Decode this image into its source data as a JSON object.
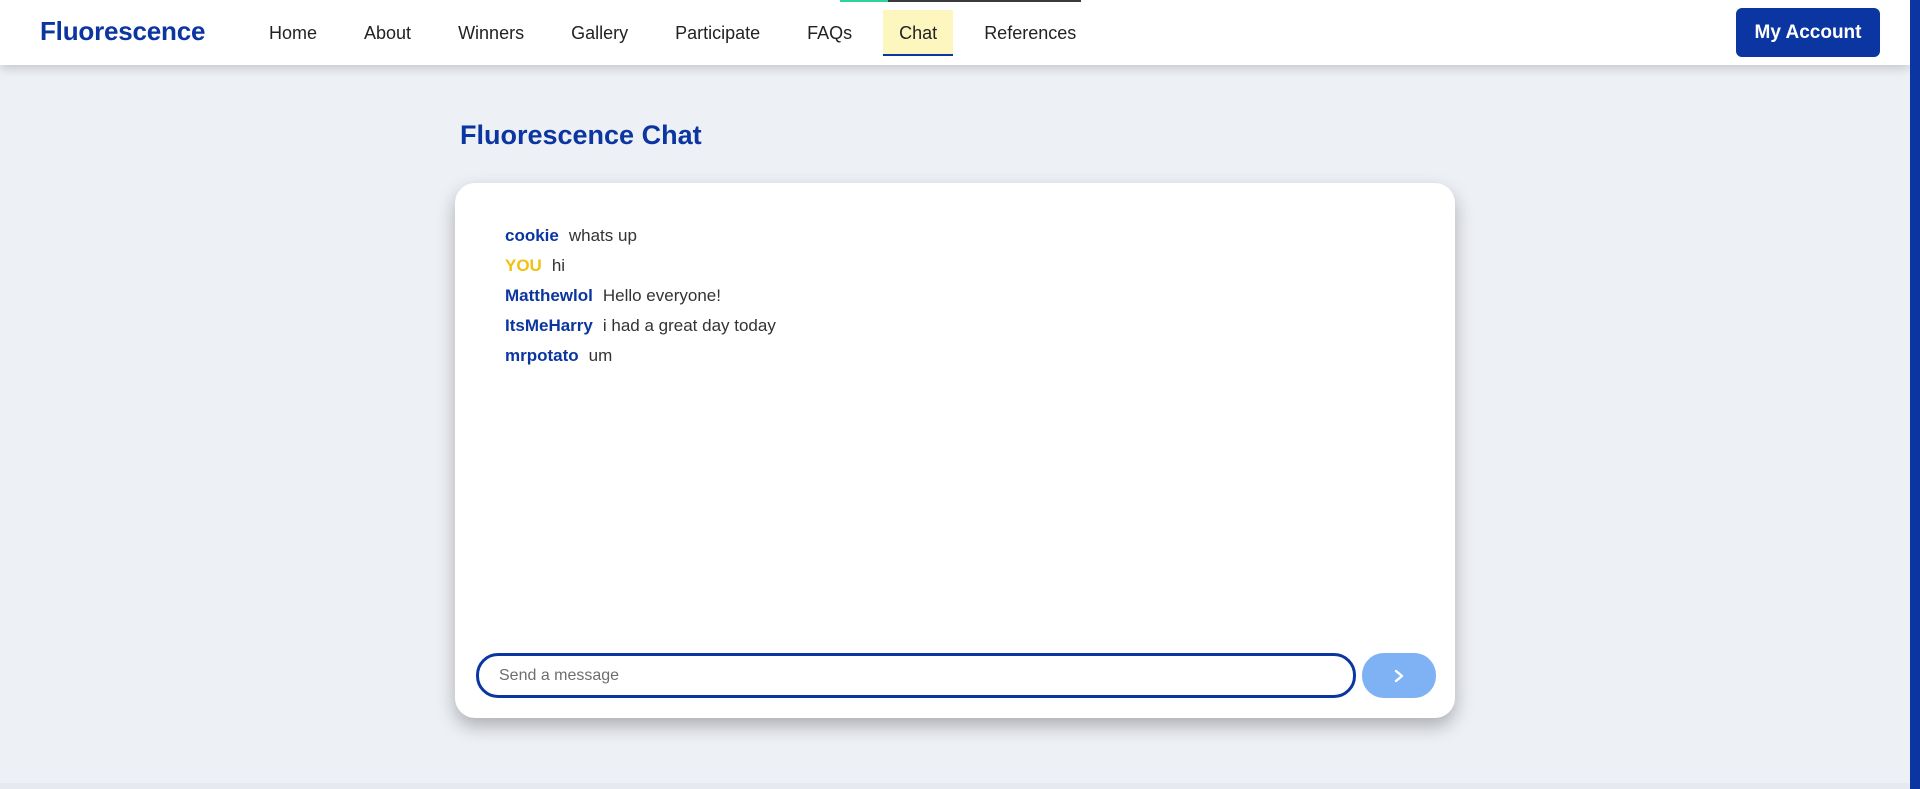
{
  "brand": {
    "logo_text": "Fluorescence"
  },
  "nav": {
    "items": [
      {
        "label": "Home"
      },
      {
        "label": "About"
      },
      {
        "label": "Winners"
      },
      {
        "label": "Gallery"
      },
      {
        "label": "Participate"
      },
      {
        "label": "FAQs"
      },
      {
        "label": "Chat",
        "active": true
      },
      {
        "label": "References"
      }
    ]
  },
  "header": {
    "account_label": "My Account"
  },
  "main": {
    "title": "Fluorescence Chat"
  },
  "chat": {
    "messages": [
      {
        "user": "cookie",
        "text": "whats up"
      },
      {
        "user": "YOU",
        "text": "hi",
        "is_self": true
      },
      {
        "user": "Matthewlol",
        "text": "Hello everyone!"
      },
      {
        "user": "ItsMeHarry",
        "text": "i had a great day today"
      },
      {
        "user": "mrpotato",
        "text": "um"
      }
    ],
    "input": {
      "placeholder": "Send a message",
      "value": ""
    },
    "send_icon": "chevron-right-icon"
  },
  "colors": {
    "brand": "#0b35a0",
    "self_user": "#f2c10f",
    "active_nav_bg": "#fdf6bf",
    "send_button": "#7fb1f5",
    "page_bg": "#edf0f5"
  }
}
